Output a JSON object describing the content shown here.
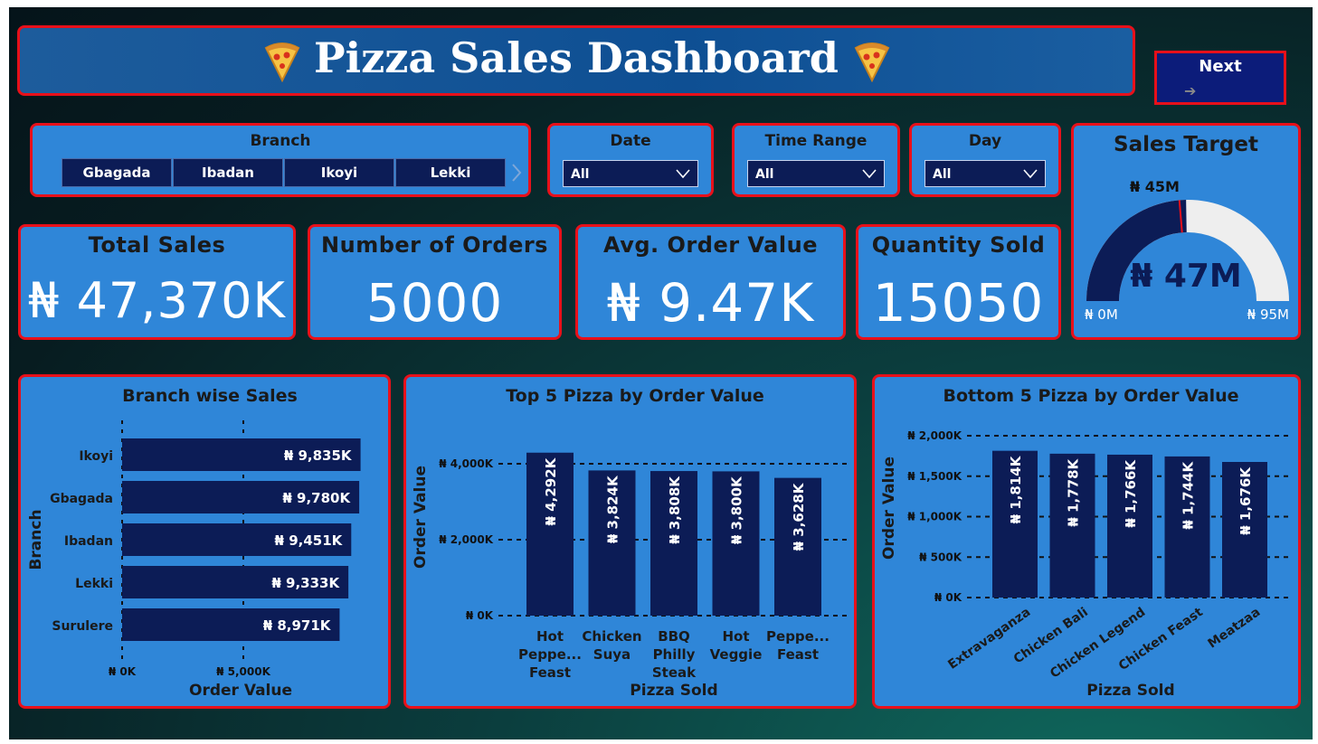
{
  "header": {
    "title": "Pizza Sales Dashboard",
    "next_label": "Next",
    "next_arrow": "➔"
  },
  "filters": {
    "branch": {
      "label": "Branch",
      "options": [
        "Gbagada",
        "Ibadan",
        "Ikoyi",
        "Lekki"
      ]
    },
    "date": {
      "label": "Date",
      "value": "All"
    },
    "time_range": {
      "label": "Time Range",
      "value": "All"
    },
    "day": {
      "label": "Day",
      "value": "All"
    }
  },
  "kpis": {
    "total_sales": {
      "label": "Total Sales",
      "value": "₦ 47,370K"
    },
    "orders": {
      "label": "Number of Orders",
      "value": "5000"
    },
    "aov": {
      "label": "Avg. Order Value",
      "value": "₦ 9.47K"
    },
    "qty": {
      "label": "Quantity Sold",
      "value": "15050"
    }
  },
  "gauge": {
    "title": "Sales Target",
    "value_label": "₦ 47M",
    "target_label": "₦ 45M",
    "min_label": "₦ 0M",
    "max_label": "₦ 95M",
    "value": 47,
    "target": 45,
    "min": 0,
    "max": 95,
    "fill_color": "#0c1c56",
    "track_color": "#eeeeee",
    "target_color": "#e8101a"
  },
  "colors": {
    "bar": "#0c1c56",
    "panel": "#2f86d8",
    "border": "#e8101a"
  },
  "chart_data": [
    {
      "type": "bar",
      "orientation": "horizontal",
      "title": "Branch wise Sales",
      "xlabel": "Order Value",
      "ylabel": "Branch",
      "categories": [
        "Ikoyi",
        "Gbagada",
        "Ibadan",
        "Lekki",
        "Surulere"
      ],
      "values": [
        9835,
        9780,
        9451,
        9333,
        8971
      ],
      "data_labels": [
        "₦ 9,835K",
        "₦ 9,780K",
        "₦ 9,451K",
        "₦ 9,333K",
        "₦ 8,971K"
      ],
      "xticks": [
        0,
        5000
      ],
      "xtick_labels": [
        "₦ 0K",
        "₦ 5,000K"
      ],
      "xlim": [
        0,
        10000
      ]
    },
    {
      "type": "bar",
      "title": "Top 5 Pizza by Order Value",
      "xlabel": "Pizza Sold",
      "ylabel": "Order Value",
      "categories": [
        [
          "Hot",
          "Peppe...",
          "Feast"
        ],
        [
          "Chicken",
          "Suya"
        ],
        [
          "BBQ",
          "Philly",
          "Steak"
        ],
        [
          "Hot",
          "Veggie"
        ],
        [
          "Peppe...",
          "Feast"
        ]
      ],
      "values": [
        4292,
        3824,
        3808,
        3800,
        3628
      ],
      "data_labels": [
        "₦ 4,292K",
        "₦ 3,824K",
        "₦ 3,808K",
        "₦ 3,800K",
        "₦ 3,628K"
      ],
      "yticks": [
        0,
        2000,
        4000
      ],
      "ytick_labels": [
        "₦ 0K",
        "₦ 2,000K",
        "₦ 4,000K"
      ],
      "ylim": [
        0,
        4000
      ]
    },
    {
      "type": "bar",
      "title": "Bottom 5 Pizza by Order Value",
      "xlabel": "Pizza Sold",
      "ylabel": "Order Value",
      "categories": [
        "Extravaganza",
        "Chicken Bali",
        "Chicken Legend",
        "Chicken Feast",
        "Meatzaa"
      ],
      "values": [
        1814,
        1778,
        1766,
        1744,
        1676
      ],
      "data_labels": [
        "₦ 1,814K",
        "₦ 1,778K",
        "₦ 1,766K",
        "₦ 1,744K",
        "₦ 1,676K"
      ],
      "yticks": [
        0,
        500,
        1000,
        1500,
        2000
      ],
      "ytick_labels": [
        "₦ 0K",
        "₦ 500K",
        "₦ 1,000K",
        "₦ 1,500K",
        "₦ 2,000K"
      ],
      "ylim": [
        0,
        2000
      ]
    }
  ]
}
